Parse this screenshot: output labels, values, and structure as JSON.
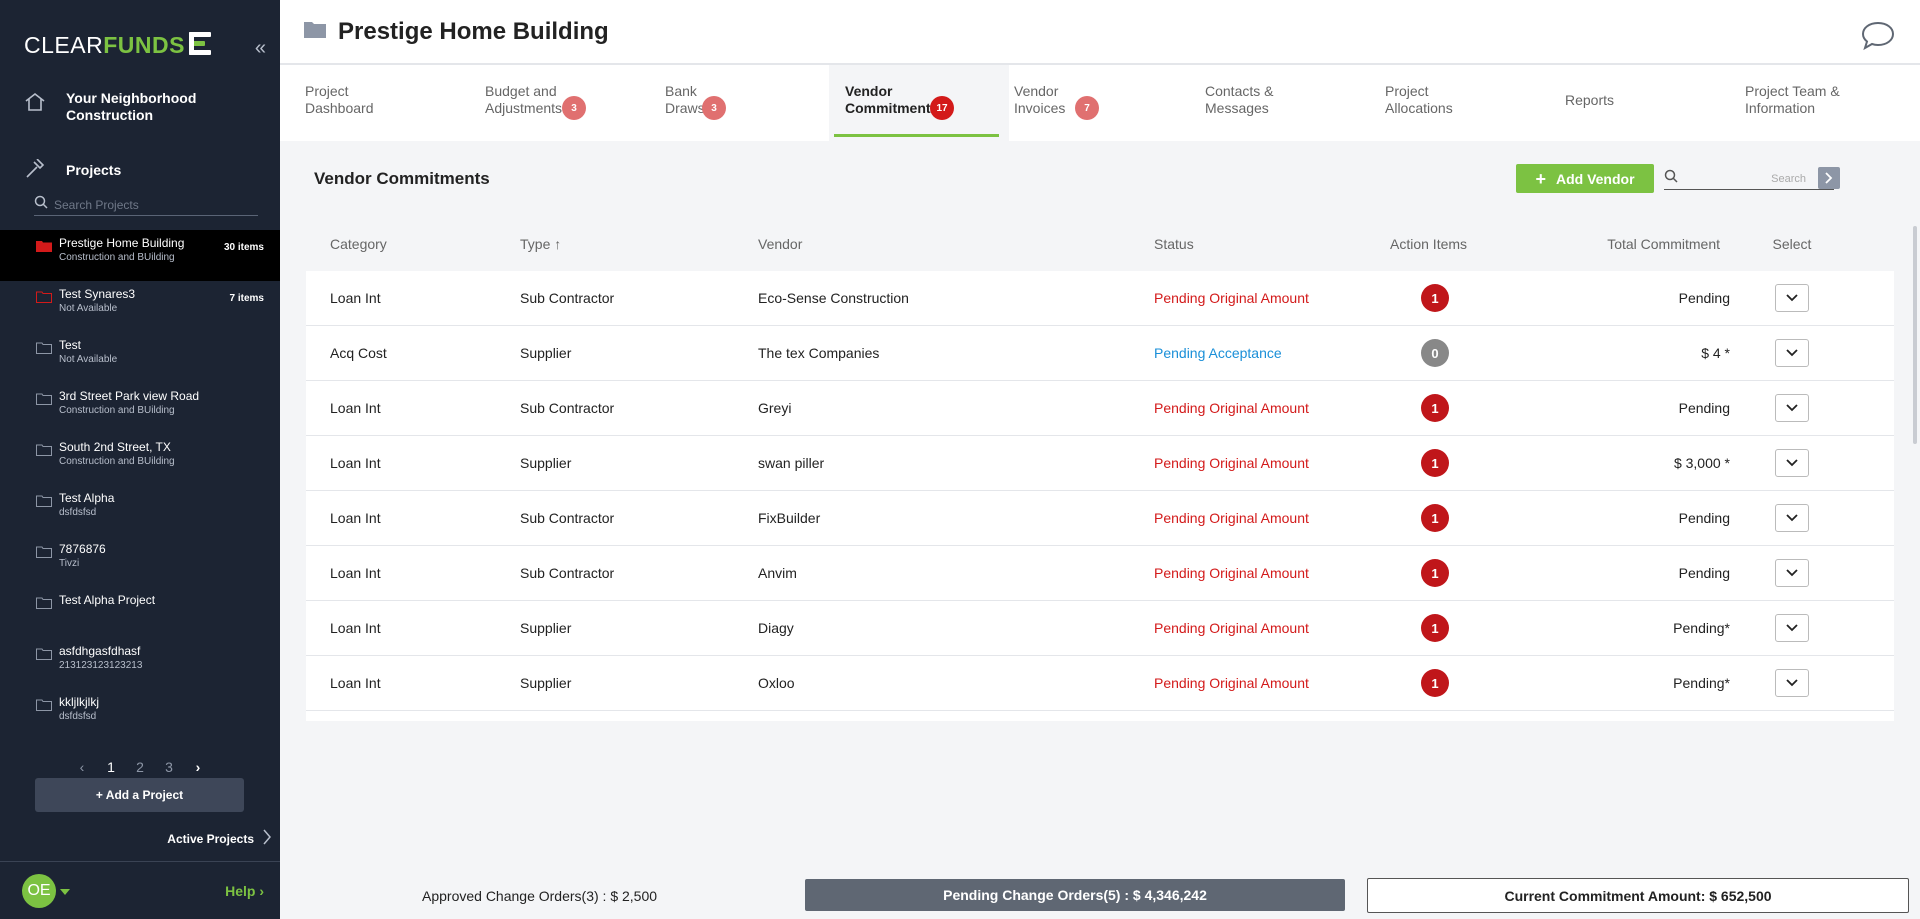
{
  "brand": {
    "clear": "CLEAR",
    "funds": "FUNDS",
    "accent": "#7cc242"
  },
  "sidebar": {
    "company": "Your Neighborhood Construction",
    "projects_label": "Projects",
    "search_placeholder": "Search Projects",
    "projects": [
      {
        "name": "Prestige Home Building",
        "sub": "Construction and BUilding",
        "count": "30 items",
        "folder": "red"
      },
      {
        "name": "Test Synares3",
        "sub": "Not Available",
        "count": "7 items",
        "folder": "red"
      },
      {
        "name": "Test",
        "sub": "Not Available",
        "count": "",
        "folder": "grey"
      },
      {
        "name": "3rd Street Park view Road",
        "sub": "Construction and BUilding",
        "count": "",
        "folder": "grey"
      },
      {
        "name": "South 2nd Street, TX",
        "sub": "Construction and BUilding",
        "count": "",
        "folder": "grey"
      },
      {
        "name": "Test Alpha",
        "sub": "dsfdsfsd",
        "count": "",
        "folder": "grey"
      },
      {
        "name": "7876876",
        "sub": "Tivzi",
        "count": "",
        "folder": "grey"
      },
      {
        "name": "Test Alpha Project",
        "sub": "",
        "count": "",
        "folder": "grey"
      },
      {
        "name": "asfdhgasfdhasf",
        "sub": "213123123123213",
        "count": "",
        "folder": "grey"
      },
      {
        "name": "kkljlkjlkj",
        "sub": "dsfdsfsd",
        "count": "",
        "folder": "grey"
      }
    ],
    "pages": [
      "1",
      "2",
      "3"
    ],
    "current_page": "1",
    "add_project": "+ Add a Project",
    "active_projects": "Active Projects",
    "avatar_initials": "OE",
    "help": "Help"
  },
  "header": {
    "title": "Prestige Home Building"
  },
  "tabs": [
    {
      "label": "Project Dashboard",
      "badge": ""
    },
    {
      "label": "Budget and Adjustments",
      "badge": "3"
    },
    {
      "label": "Bank Draws",
      "badge": "3"
    },
    {
      "label": "Vendor Commitments",
      "badge": "17",
      "active": true
    },
    {
      "label": "Vendor Invoices",
      "badge": "7"
    },
    {
      "label": "Contacts & Messages",
      "badge": ""
    },
    {
      "label": "Project Allocations",
      "badge": ""
    },
    {
      "label": "Reports",
      "badge": ""
    },
    {
      "label": "Project Team & Information",
      "badge": ""
    }
  ],
  "panel": {
    "title": "Vendor Commitments",
    "add_vendor": "Add Vendor",
    "search_placeholder": "Search"
  },
  "table": {
    "headers": {
      "category": "Category",
      "type": "Type",
      "vendor": "Vendor",
      "status": "Status",
      "action_items": "Action Items",
      "total": "Total Commitment",
      "select": "Select"
    },
    "rows": [
      {
        "category": "Loan Int",
        "type": "Sub Contractor",
        "vendor": "Eco-Sense Construction",
        "status": "Pending Original Amount",
        "status_color": "#d31a1a",
        "action": "1",
        "total": "Pending"
      },
      {
        "category": "Acq Cost",
        "type": "Supplier",
        "vendor": "The tex Companies",
        "status": "Pending Acceptance",
        "status_color": "#1a8fd8",
        "action": "0",
        "total": "$  4 *"
      },
      {
        "category": "Loan Int",
        "type": "Sub Contractor",
        "vendor": "Greyi",
        "status": "Pending Original Amount",
        "status_color": "#d31a1a",
        "action": "1",
        "total": "Pending"
      },
      {
        "category": "Loan Int",
        "type": "Supplier",
        "vendor": "swan piller",
        "status": "Pending Original Amount",
        "status_color": "#d31a1a",
        "action": "1",
        "total": "$  3,000 *"
      },
      {
        "category": "Loan Int",
        "type": "Sub Contractor",
        "vendor": "FixBuilder",
        "status": "Pending Original Amount",
        "status_color": "#d31a1a",
        "action": "1",
        "total": "Pending"
      },
      {
        "category": "Loan Int",
        "type": "Sub Contractor",
        "vendor": "Anvim",
        "status": "Pending Original Amount",
        "status_color": "#d31a1a",
        "action": "1",
        "total": "Pending"
      },
      {
        "category": "Loan Int",
        "type": "Supplier",
        "vendor": "Diagy",
        "status": "Pending Original Amount",
        "status_color": "#d31a1a",
        "action": "1",
        "total": "Pending*"
      },
      {
        "category": "Loan Int",
        "type": "Supplier",
        "vendor": "Oxloo",
        "status": "Pending Original Amount",
        "status_color": "#d31a1a",
        "action": "1",
        "total": "Pending*"
      }
    ]
  },
  "footer": {
    "approved": "Approved Change Orders(3) : $ 2,500",
    "pending": "Pending Change Orders(5) : $ 4,346,242",
    "current": "Current Commitment Amount: $ 652,500"
  }
}
